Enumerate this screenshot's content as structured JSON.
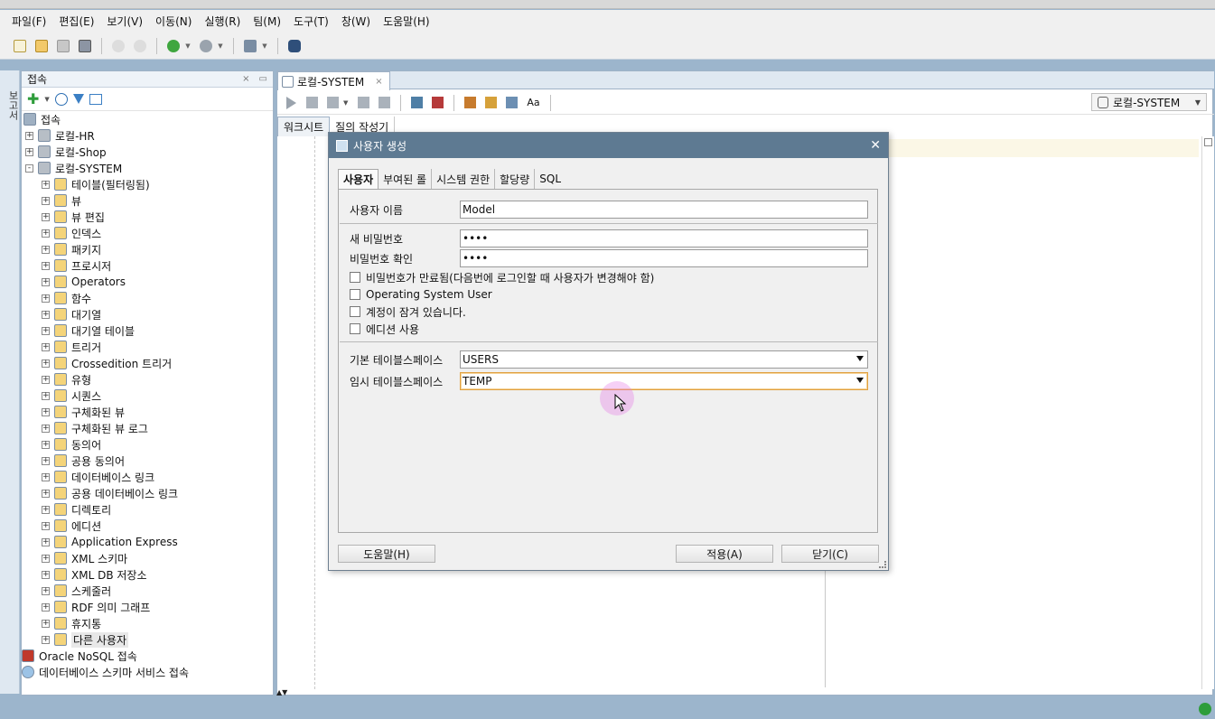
{
  "menu": [
    "파일(F)",
    "편집(E)",
    "보기(V)",
    "이동(N)",
    "실행(R)",
    "팀(M)",
    "도구(T)",
    "창(W)",
    "도움말(H)"
  ],
  "left_strip": [
    "보고서"
  ],
  "connections": {
    "title": "접속",
    "root_label": "접속",
    "items": [
      {
        "label": "로컬-HR",
        "level": 1,
        "expander": "+"
      },
      {
        "label": "로컬-Shop",
        "level": 1,
        "expander": "+"
      },
      {
        "label": "로컬-SYSTEM",
        "level": 1,
        "expander": "-"
      },
      {
        "label": "테이블(필터링됨)",
        "level": 2,
        "expander": "+"
      },
      {
        "label": "뷰",
        "level": 2,
        "expander": "+"
      },
      {
        "label": "뷰 편집",
        "level": 2,
        "expander": "+"
      },
      {
        "label": "인덱스",
        "level": 2,
        "expander": "+"
      },
      {
        "label": "패키지",
        "level": 2,
        "expander": "+"
      },
      {
        "label": "프로시저",
        "level": 2,
        "expander": "+"
      },
      {
        "label": "Operators",
        "level": 2,
        "expander": "+"
      },
      {
        "label": "함수",
        "level": 2,
        "expander": "+"
      },
      {
        "label": "대기열",
        "level": 2,
        "expander": "+"
      },
      {
        "label": "대기열 테이블",
        "level": 2,
        "expander": "+"
      },
      {
        "label": "트리거",
        "level": 2,
        "expander": "+"
      },
      {
        "label": "Crossedition 트리거",
        "level": 2,
        "expander": "+"
      },
      {
        "label": "유형",
        "level": 2,
        "expander": "+"
      },
      {
        "label": "시퀀스",
        "level": 2,
        "expander": "+"
      },
      {
        "label": "구체화된 뷰",
        "level": 2,
        "expander": "+"
      },
      {
        "label": "구체화된 뷰 로그",
        "level": 2,
        "expander": "+"
      },
      {
        "label": "동의어",
        "level": 2,
        "expander": "+"
      },
      {
        "label": "공용 동의어",
        "level": 2,
        "expander": "+"
      },
      {
        "label": "데이터베이스 링크",
        "level": 2,
        "expander": "+"
      },
      {
        "label": "공용 데이터베이스 링크",
        "level": 2,
        "expander": "+"
      },
      {
        "label": "디렉토리",
        "level": 2,
        "expander": "+"
      },
      {
        "label": "에디션",
        "level": 2,
        "expander": "+"
      },
      {
        "label": "Application Express",
        "level": 2,
        "expander": "+"
      },
      {
        "label": "XML 스키마",
        "level": 2,
        "expander": "+"
      },
      {
        "label": "XML DB 저장소",
        "level": 2,
        "expander": "+"
      },
      {
        "label": "스케줄러",
        "level": 2,
        "expander": "+"
      },
      {
        "label": "RDF 의미 그래프",
        "level": 2,
        "expander": "+"
      },
      {
        "label": "휴지통",
        "level": 2,
        "expander": "+"
      },
      {
        "label": "다른 사용자",
        "level": 2,
        "expander": "+",
        "selected": true
      }
    ],
    "footer_items": [
      "Oracle NoSQL 접속",
      "데이터베이스 스키마 서비스 접속"
    ]
  },
  "editor": {
    "tab_label": "로컬-SYSTEM",
    "connection_selector": "로컬-SYSTEM",
    "subtabs": [
      "워크시트",
      "질의 작성기"
    ]
  },
  "dialog": {
    "title": "사용자 생성",
    "tabs": [
      "사용자",
      "부여된 롤",
      "시스템 권한",
      "할당량",
      "SQL"
    ],
    "username_label": "사용자 이름",
    "username_value": "Model",
    "new_password_label": "새 비밀번호",
    "new_password_value": "••••",
    "confirm_password_label": "비밀번호 확인",
    "confirm_password_value": "••••",
    "checkboxes": [
      "비밀번호가 만료됨(다음번에 로그인할 때 사용자가 변경해야 함)",
      "Operating System User",
      "계정이 잠겨 있습니다.",
      "에디션 사용"
    ],
    "default_ts_label": "기본 테이블스페이스",
    "default_ts_value": "USERS",
    "temp_ts_label": "임시 테이블스페이스",
    "temp_ts_value": "TEMP",
    "help_button": "도움말(H)",
    "apply_button": "적용(A)",
    "close_button": "닫기(C)"
  },
  "colors": {
    "dialog_title_bg": "#5e7a92",
    "focus_border": "#e0a040",
    "cursor_highlight": "#e678e6"
  }
}
